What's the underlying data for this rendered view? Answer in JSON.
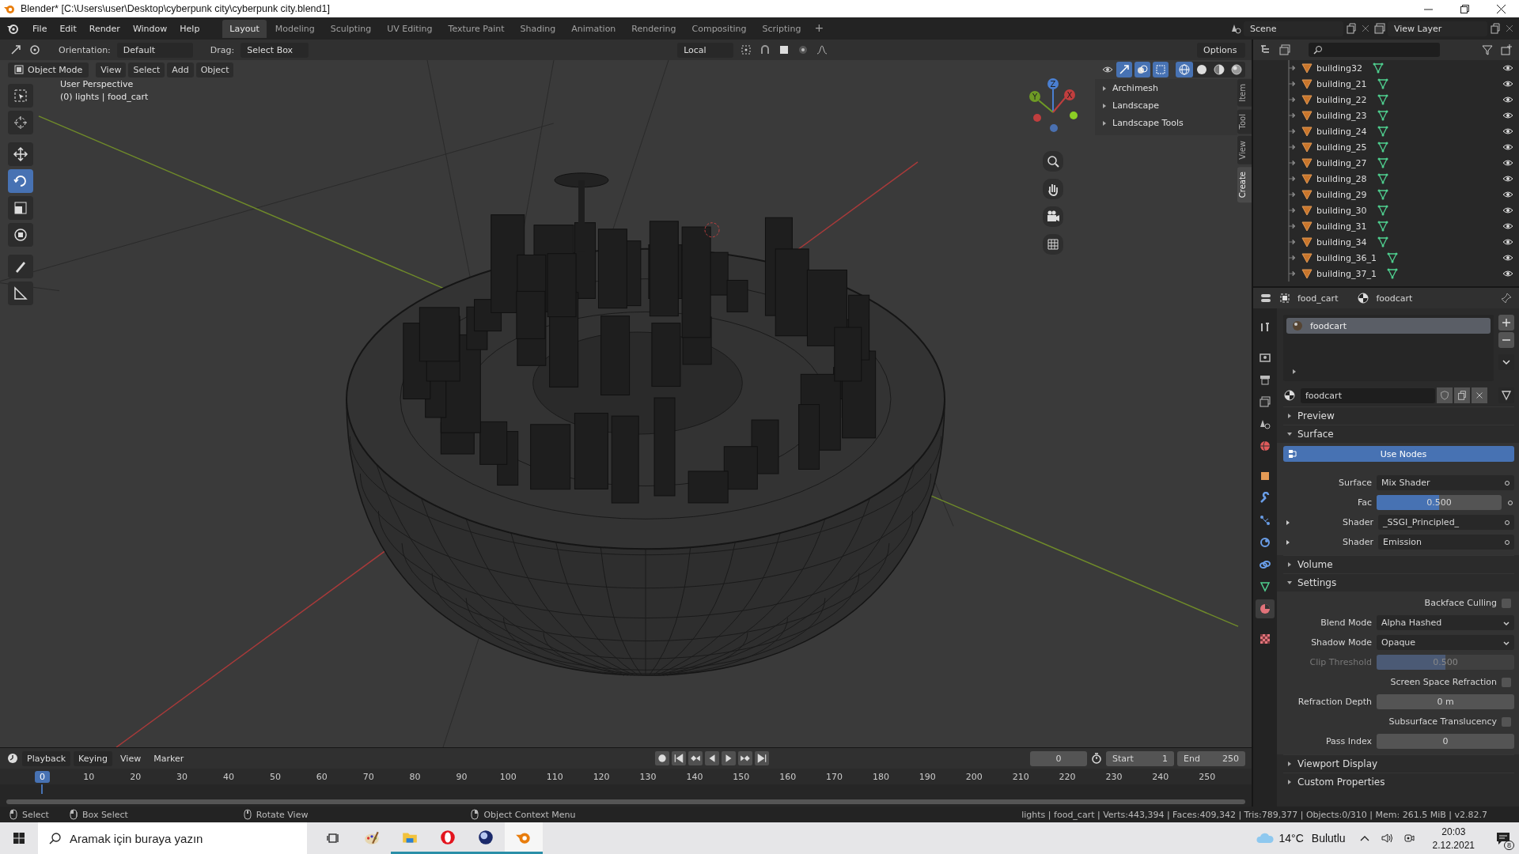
{
  "window": {
    "title": "Blender* [C:\\Users\\user\\Desktop\\cyberpunk city\\cyberpunk city.blend1]"
  },
  "menu": [
    "File",
    "Edit",
    "Render",
    "Window",
    "Help"
  ],
  "workspaces": [
    {
      "label": "Layout",
      "selected": true
    },
    {
      "label": "Modeling",
      "selected": false
    },
    {
      "label": "Sculpting",
      "selected": false
    },
    {
      "label": "UV Editing",
      "selected": false
    },
    {
      "label": "Texture Paint",
      "selected": false
    },
    {
      "label": "Shading",
      "selected": false
    },
    {
      "label": "Animation",
      "selected": false
    },
    {
      "label": "Rendering",
      "selected": false
    },
    {
      "label": "Compositing",
      "selected": false
    },
    {
      "label": "Scripting",
      "selected": false
    }
  ],
  "add_workspace": "+",
  "scene": "Scene",
  "view_layer": "View Layer",
  "tool_header": {
    "orientation_label": "Orientation:",
    "orientation": "Default",
    "drag_label": "Drag:",
    "drag": "Select Box",
    "pivot": "Local",
    "options": "Options"
  },
  "viewport": {
    "mode": "Object Mode",
    "menus": [
      "View",
      "Select",
      "Add",
      "Object"
    ],
    "info": [
      "User Perspective",
      "(0) lights | food_cart"
    ],
    "tools": [
      {
        "kind": "select",
        "selected": false
      },
      {
        "kind": "cursor",
        "selected": false
      },
      {
        "kind": "move",
        "selected": false
      },
      {
        "kind": "rotate",
        "selected": true
      },
      {
        "kind": "scale",
        "selected": false
      },
      {
        "kind": "transform",
        "selected": false
      },
      {
        "kind": "annotate",
        "selected": false
      },
      {
        "kind": "measure",
        "selected": false
      }
    ],
    "shading": [
      {
        "kind": "wireframe",
        "selected": true
      },
      {
        "kind": "solid",
        "selected": false
      },
      {
        "kind": "material",
        "selected": false
      },
      {
        "kind": "rendered",
        "selected": false
      }
    ],
    "gizmo_axes": [
      "Z",
      "Y",
      "X"
    ],
    "sidebar_panels": [
      "Archimesh",
      "Landscape",
      "Landscape Tools"
    ],
    "sidebar_tabs": [
      {
        "label": "Item",
        "selected": false
      },
      {
        "label": "Tool",
        "selected": false
      },
      {
        "label": "View",
        "selected": false
      },
      {
        "label": "Create",
        "selected": true
      }
    ]
  },
  "outliner": {
    "items": [
      "building32",
      "building_21",
      "building_22",
      "building_23",
      "building_24",
      "building_25",
      "building_27",
      "building_28",
      "building_29",
      "building_30",
      "building_31",
      "building_34",
      "building_36_1",
      "building_37_1"
    ]
  },
  "properties": {
    "object": "food_cart",
    "material_name": "foodcart",
    "tabs": [
      {
        "kind": "tool",
        "selected": false
      },
      {
        "kind": "render",
        "selected": false
      },
      {
        "kind": "output",
        "selected": false
      },
      {
        "kind": "view_layer",
        "selected": false
      },
      {
        "kind": "scene",
        "selected": false
      },
      {
        "kind": "world",
        "selected": false
      },
      {
        "kind": "object",
        "selected": false
      },
      {
        "kind": "modifiers",
        "selected": false
      },
      {
        "kind": "particles",
        "selected": false
      },
      {
        "kind": "physics",
        "selected": false
      },
      {
        "kind": "constraints",
        "selected": false
      },
      {
        "kind": "data",
        "selected": false
      },
      {
        "kind": "material",
        "selected": true
      },
      {
        "kind": "texture",
        "selected": false
      }
    ],
    "slots": [
      {
        "name": "foodcart",
        "selected": true
      }
    ],
    "material": "foodcart",
    "sections": [
      {
        "label": "Preview",
        "expanded": false
      },
      {
        "label": "Surface",
        "expanded": true,
        "button": "Use Nodes",
        "rows": [
          {
            "kind": "socket",
            "label": "Surface",
            "value": "Mix Shader"
          },
          {
            "kind": "slider",
            "label": "Fac",
            "value": "0.500",
            "level": 0.5,
            "disabled": false
          },
          {
            "kind": "linked_socket",
            "label": "Shader",
            "value": "_SSGI_Principled_"
          },
          {
            "kind": "linked_socket",
            "label": "Shader",
            "value": "Emission"
          }
        ]
      },
      {
        "label": "Volume",
        "expanded": false
      },
      {
        "label": "Settings",
        "expanded": true,
        "rows": [
          {
            "kind": "checkbox",
            "label": "Backface Culling",
            "checked": false
          },
          {
            "kind": "enum",
            "label": "Blend Mode",
            "value": "Alpha Hashed"
          },
          {
            "kind": "enum",
            "label": "Shadow Mode",
            "value": "Opaque"
          },
          {
            "kind": "slider",
            "label": "Clip Threshold",
            "value": "0.500",
            "level": 0.5,
            "disabled": true
          },
          {
            "kind": "checkbox",
            "label": "Screen Space Refraction",
            "checked": false
          },
          {
            "kind": "number",
            "label": "Refraction Depth",
            "value": "0 m"
          },
          {
            "kind": "checkbox",
            "label": "Subsurface Translucency",
            "checked": false
          },
          {
            "kind": "number",
            "label": "Pass Index",
            "value": "0"
          }
        ]
      },
      {
        "label": "Viewport Display",
        "expanded": false
      },
      {
        "label": "Custom Properties",
        "expanded": false
      }
    ]
  },
  "timeline": {
    "menus": [
      "Playback",
      "Keying",
      "View",
      "Marker"
    ],
    "current_frame": "0",
    "frame_field": "0",
    "start_label": "Start",
    "start": "1",
    "end_label": "End",
    "end": "250",
    "ticks": [
      "10",
      "20",
      "30",
      "40",
      "50",
      "60",
      "70",
      "80",
      "90",
      "100",
      "110",
      "120",
      "130",
      "140",
      "150",
      "160",
      "170",
      "180",
      "190",
      "200",
      "210",
      "220",
      "230",
      "240",
      "250"
    ]
  },
  "status_bar": {
    "hints": [
      {
        "kind": "left",
        "label": "Select"
      },
      {
        "kind": "drag",
        "label": "Box Select"
      },
      {
        "kind": "middle",
        "label": "Rotate View"
      },
      {
        "kind": "right",
        "label": "Object Context Menu"
      }
    ],
    "stats": "lights | food_cart | Verts:443,394 | Faces:409,342 | Tris:789,377 | Objects:0/310 | Mem: 261.5 MiB | v2.82.7"
  },
  "taskbar": {
    "search_placeholder": "Aramak için buraya yazın",
    "apps": [
      {
        "kind": "paint",
        "running": false,
        "selected": false
      },
      {
        "kind": "explorer",
        "running": true,
        "selected": false
      },
      {
        "kind": "opera",
        "running": true,
        "selected": false
      },
      {
        "kind": "cinema",
        "running": true,
        "selected": false
      },
      {
        "kind": "blender",
        "running": true,
        "selected": true
      }
    ],
    "temperature": "14°C",
    "weather": "Bulutlu",
    "time": "20:03",
    "date": "2.12.2021",
    "notifications": "8"
  }
}
